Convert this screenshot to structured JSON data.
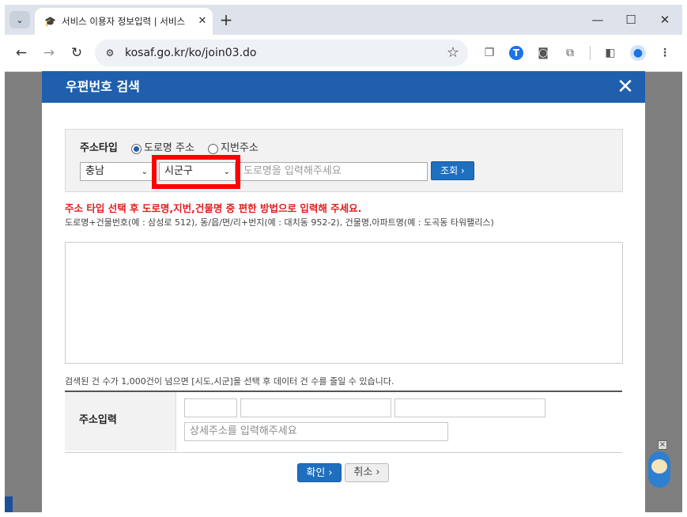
{
  "browser": {
    "tab_title": "서비스 이용자 정보입력 | 서비스 이용",
    "url": "kosaf.go.kr/ko/join03.do"
  },
  "modal": {
    "title": "우편번호 검색",
    "close_glyph": "✕"
  },
  "search": {
    "addr_type_label": "주소타입",
    "radio_road": "도로명 주소",
    "radio_jibun": "지번주소",
    "selected_type": "도로명 주소",
    "province_value": "충남",
    "district_value": "시군구",
    "road_placeholder": "도로명을 입력해주세요",
    "lookup_label": "조회 ›"
  },
  "messages": {
    "warning": "주소 타입 선택 후 도로명,지번,건물명 중 편한 방법으로 입력해 주세요.",
    "example": "도로명+건물번호(예 : 삼성로 512), 동/읍/면/리+번지(예 : 대치동 952-2), 건물명,아파트명(예 : 도곡동 타워팰리스)",
    "count_note": "검색된 건 수가 1,000건이 넘으면 [시도,시군]을 선택 후 데이터 건 수를 줄일 수 있습니다."
  },
  "address_input": {
    "label": "주소입력",
    "detail_placeholder": "상세주소를 입력해주세요"
  },
  "buttons": {
    "confirm": "확인 ›",
    "cancel": "취소 ›"
  },
  "colors": {
    "header_blue": "#1f5fae",
    "warning_red": "#e02020",
    "highlight_red": "#ff0000"
  }
}
